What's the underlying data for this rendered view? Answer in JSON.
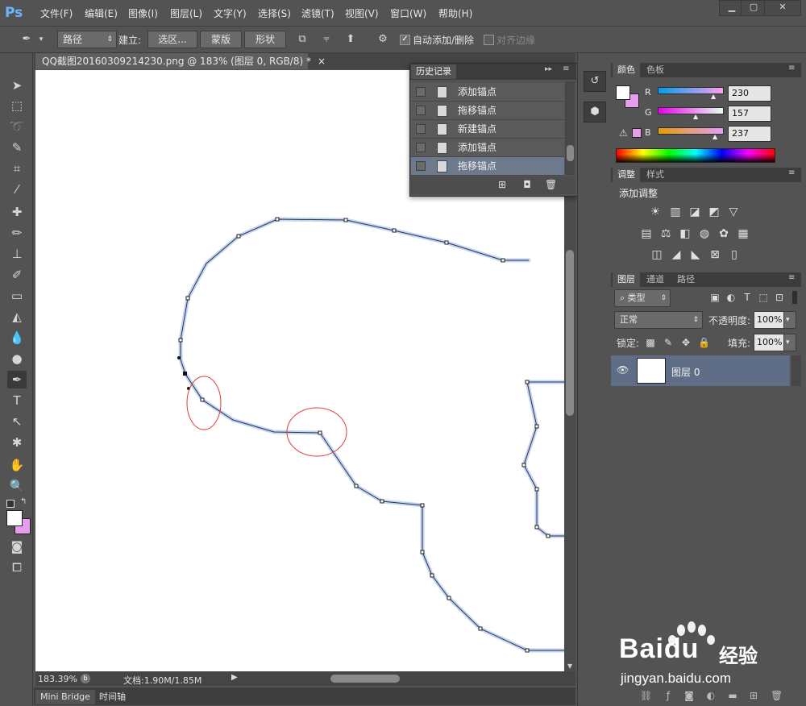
{
  "app": {
    "logo": "Ps"
  },
  "menu": [
    "文件(F)",
    "编辑(E)",
    "图像(I)",
    "图层(L)",
    "文字(Y)",
    "选择(S)",
    "滤镜(T)",
    "视图(V)",
    "窗口(W)",
    "帮助(H)"
  ],
  "options_bar": {
    "mode": "路径",
    "build_label": "建立:",
    "selection_btn": "选区...",
    "mask_btn": "蒙版",
    "shape_btn": "形状",
    "auto_add_delete": "自动添加/删除",
    "align_edges": "对齐边缘",
    "auto_add_checked": true,
    "align_checked": false
  },
  "document": {
    "tab_title": "QQ截图20160309214230.png @ 183% (图层 0, RGB/8) *",
    "zoom": "183.39%",
    "doc_info": "文档:1.90M/1.85M"
  },
  "bottom_tabs": [
    "Mini Bridge",
    "时间轴"
  ],
  "history": {
    "title": "历史记录",
    "items": [
      "添加锚点",
      "拖移锚点",
      "新建锚点",
      "添加锚点",
      "拖移锚点"
    ],
    "selected_index": 4
  },
  "color_panel": {
    "tabs": [
      "颜色",
      "色板"
    ],
    "channels": [
      {
        "label": "R",
        "value": "230"
      },
      {
        "label": "G",
        "value": "157"
      },
      {
        "label": "B",
        "value": "237"
      }
    ],
    "foreground": "#ffffff",
    "background": "#e69ded"
  },
  "adjust_panel": {
    "tabs": [
      "调整",
      "样式"
    ],
    "title": "添加调整"
  },
  "layers_panel": {
    "tabs": [
      "图层",
      "通道",
      "路径"
    ],
    "filter": "类型",
    "blend_mode": "正常",
    "opacity_label": "不透明度:",
    "opacity": "100%",
    "lock_label": "锁定:",
    "fill_label": "填充:",
    "fill": "100%",
    "layers": [
      {
        "name": "图层 0"
      }
    ]
  },
  "watermark": {
    "brand": "Baidu",
    "brand_cn": "经验",
    "url": "jingyan.baidu.com"
  }
}
